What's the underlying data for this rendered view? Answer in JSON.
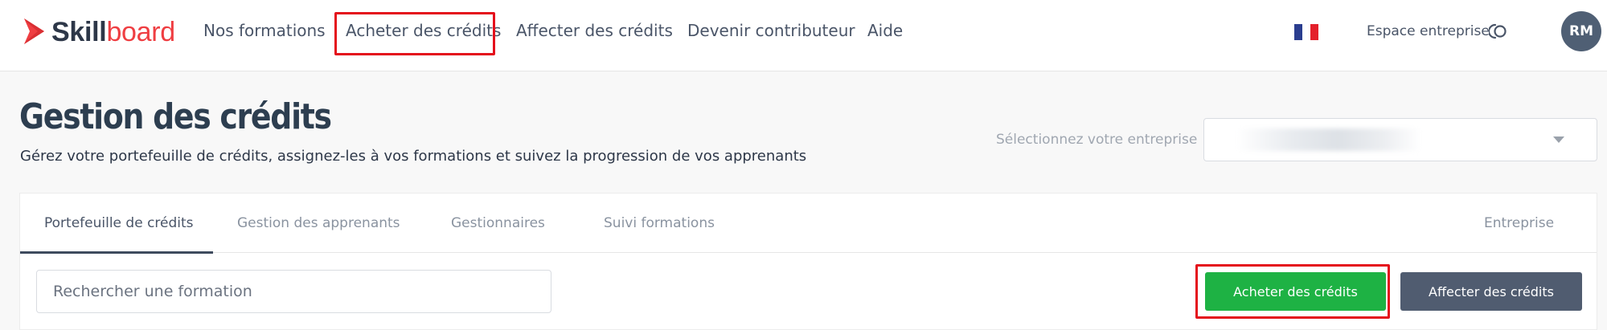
{
  "brand": {
    "name_part1": "Skill",
    "name_part2": "board",
    "accent_color": "#ef3e42"
  },
  "nav": {
    "items": [
      {
        "label": "Nos formations"
      },
      {
        "label": "Acheter des crédits",
        "highlighted": true
      },
      {
        "label": "Affecter des crédits"
      },
      {
        "label": "Devenir contributeur"
      },
      {
        "label": "Aide"
      }
    ],
    "language_flag": "fr-flag-icon",
    "espace_label": "Espace entreprise",
    "espace_toggle_icon": "toggle-icon",
    "avatar_initials": "RM"
  },
  "header": {
    "title": "Gestion des crédits",
    "subtitle": "Gérez votre portefeuille de crédits, assignez-les à vos formations et suivez la progression de vos apprenants",
    "company_label": "Sélectionnez votre entreprise"
  },
  "tabs": [
    {
      "label": "Portefeuille de crédits",
      "active": true
    },
    {
      "label": "Gestion des apprenants"
    },
    {
      "label": "Gestionnaires"
    },
    {
      "label": "Suivi formations"
    },
    {
      "label": "Entreprise"
    }
  ],
  "toolbar": {
    "search_placeholder": "Rechercher une formation",
    "buy_label": "Acheter des crédits",
    "assign_label": "Affecter des crédits",
    "buy_color": "#1eb244",
    "assign_color": "#505c70"
  },
  "colors": {
    "highlight": "#e4101c",
    "active_tab": "#3e4b5e"
  }
}
